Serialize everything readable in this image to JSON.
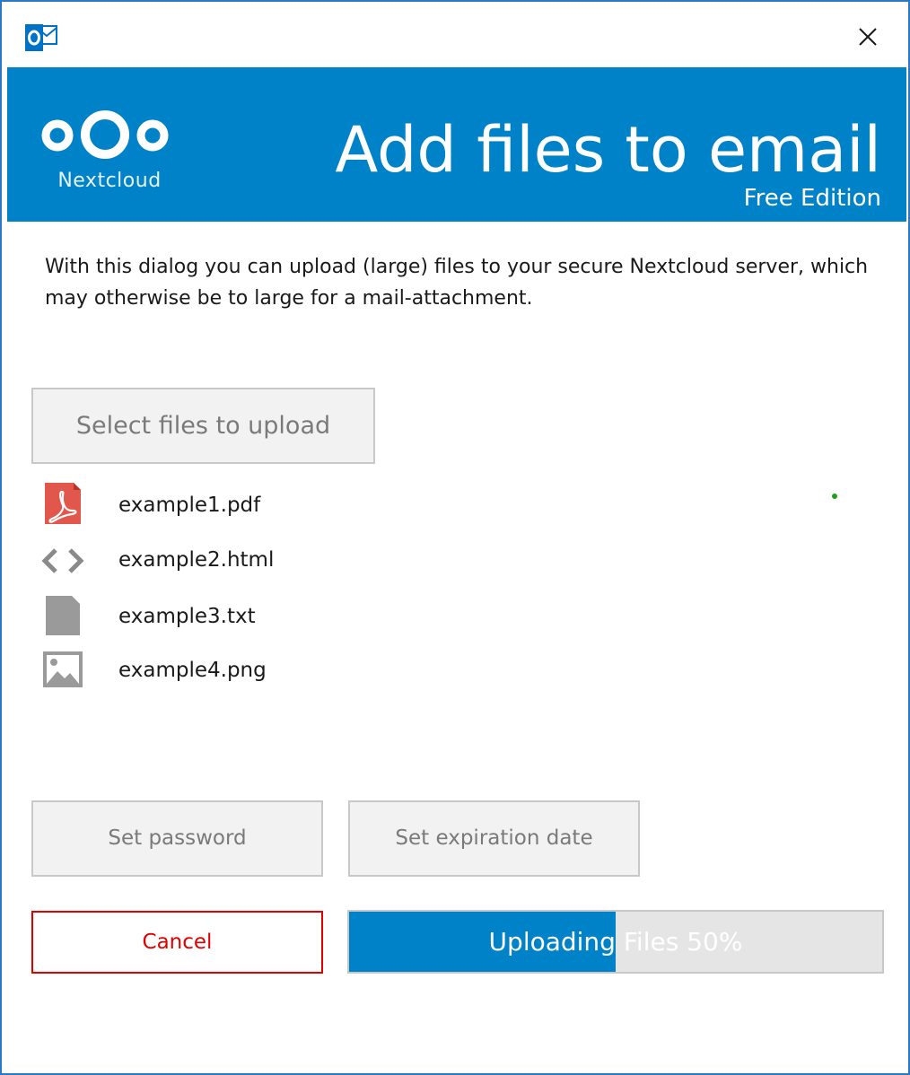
{
  "window": {
    "close_icon": "close-icon",
    "app_icon": "outlook-icon"
  },
  "banner": {
    "logo_text": "Nextcloud",
    "title": "Add files to email",
    "subtitle": "Free Edition",
    "background_color": "#0082c9"
  },
  "intro": {
    "text": "With this dialog you can upload (large) files to your secure Nextcloud server, which may otherwise be to large for a mail-attachment."
  },
  "actions": {
    "select_files_label": "Select files to upload",
    "set_password_label": "Set password",
    "set_expiration_label": "Set expiration date",
    "cancel_label": "Cancel"
  },
  "files": [
    {
      "name": "example1.pdf",
      "icon": "pdf-icon"
    },
    {
      "name": "example2.html",
      "icon": "code-icon"
    },
    {
      "name": "example3.txt",
      "icon": "text-file-icon"
    },
    {
      "name": "example4.png",
      "icon": "image-icon"
    }
  ],
  "progress": {
    "label": "Uploading Files 50%",
    "percent": 50,
    "fill_color": "#0082c9",
    "cancel_color": "#e00000"
  }
}
